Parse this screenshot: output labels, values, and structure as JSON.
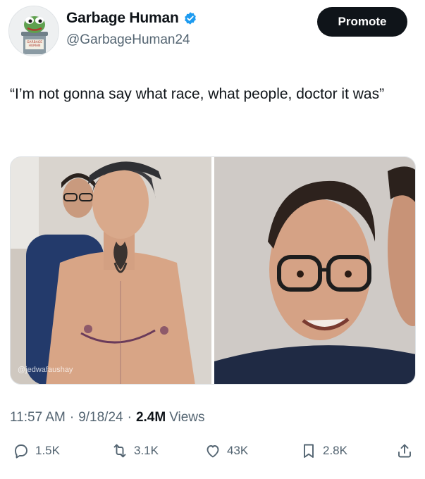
{
  "author": {
    "display_name": "Garbage Human",
    "handle": "@GarbageHuman24",
    "avatar_caption": "GARBAGE HUMAN"
  },
  "promote_label": "Promote",
  "tweet_text": "“I’m not gonna say what race, what people, doctor it was”",
  "media": {
    "watermark": "@jedwafaushay"
  },
  "meta": {
    "time": "11:57 AM",
    "date": "9/18/24",
    "views_count": "2.4M",
    "views_label": "Views"
  },
  "actions": {
    "replies": "1.5K",
    "reposts": "3.1K",
    "likes": "43K",
    "bookmarks": "2.8K"
  },
  "colors": {
    "text_primary": "#0f1419",
    "text_secondary": "#536471",
    "verified_blue": "#1d9bf0",
    "button_dark": "#0f1419"
  },
  "icons": [
    "verified-badge-icon",
    "reply-icon",
    "repost-icon",
    "like-icon",
    "bookmark-icon",
    "share-icon"
  ]
}
